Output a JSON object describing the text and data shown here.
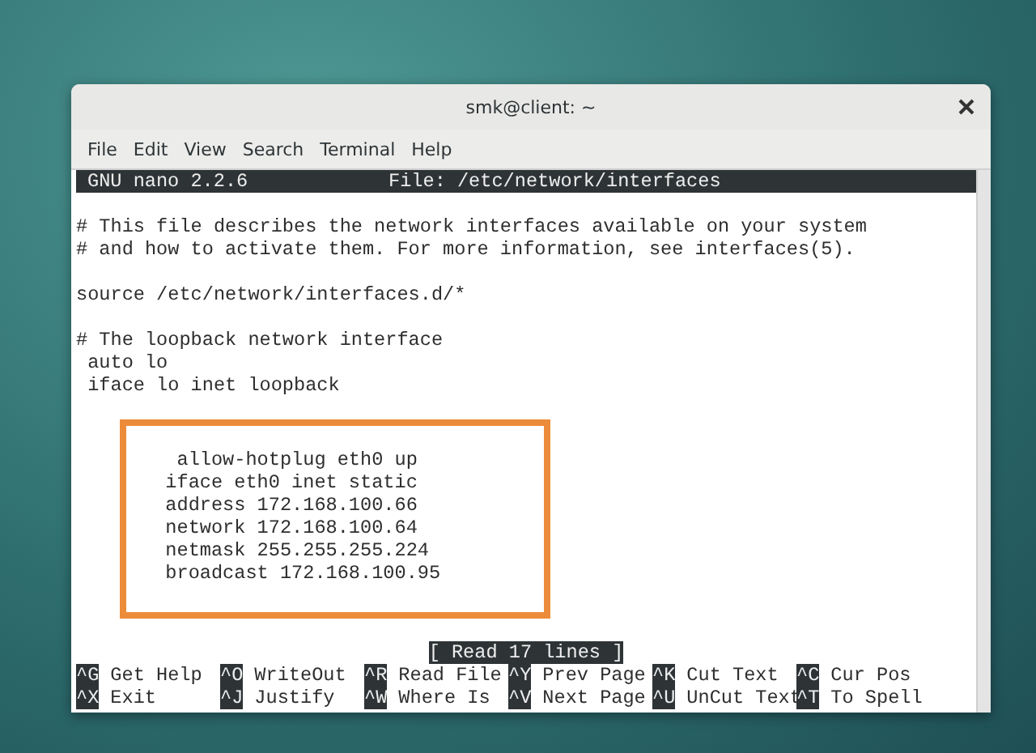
{
  "window": {
    "title": "smk@client: ~"
  },
  "menu": [
    "File",
    "Edit",
    "View",
    "Search",
    "Terminal",
    "Help"
  ],
  "nano": {
    "version": "GNU nano 2.2.6",
    "file": "File: /etc/network/interfaces",
    "paragraphs": [
      [
        "# This file describes the network interfaces available on your system",
        "# and how to activate them. For more information, see interfaces(5)."
      ],
      [
        "source /etc/network/interfaces.d/*"
      ],
      [
        "# The loopback network interface",
        " auto lo",
        " iface lo inet loopback"
      ]
    ],
    "highlighted_block": [
      "   allow-hotplug eth0 up",
      "  iface eth0 inet static",
      "  address 172.168.100.66",
      "  network 172.168.100.64",
      "  netmask 255.255.255.224",
      "  broadcast 172.168.100.95"
    ],
    "status": "[ Read 17 lines ]",
    "shortcuts": [
      [
        {
          "key": "^G",
          "label": "Get Help"
        },
        {
          "key": "^O",
          "label": "WriteOut"
        },
        {
          "key": "^R",
          "label": "Read File"
        },
        {
          "key": "^Y",
          "label": "Prev Page"
        },
        {
          "key": "^K",
          "label": "Cut Text"
        },
        {
          "key": "^C",
          "label": "Cur Pos"
        }
      ],
      [
        {
          "key": "^X",
          "label": "Exit"
        },
        {
          "key": "^J",
          "label": "Justify"
        },
        {
          "key": "^W",
          "label": "Where Is"
        },
        {
          "key": "^V",
          "label": "Next Page"
        },
        {
          "key": "^U",
          "label": "UnCut Text"
        },
        {
          "key": "^T",
          "label": "To Spell"
        }
      ]
    ]
  }
}
